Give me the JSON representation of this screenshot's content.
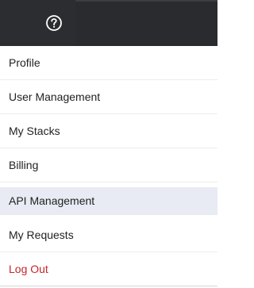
{
  "topbar": {
    "help_icon": "question-circle-icon",
    "background": "#2c2d30",
    "icon_color": "#ffffff"
  },
  "menu": {
    "items": [
      {
        "label": "Profile"
      },
      {
        "label": "User Management"
      },
      {
        "label": "My Stacks"
      },
      {
        "label": "Billing"
      },
      {
        "label": "API Management"
      },
      {
        "label": "My Requests"
      },
      {
        "label": "Log Out"
      }
    ],
    "active_item": "API Management",
    "active_background": "#e9ebf4",
    "logout_color": "#c8252c"
  }
}
